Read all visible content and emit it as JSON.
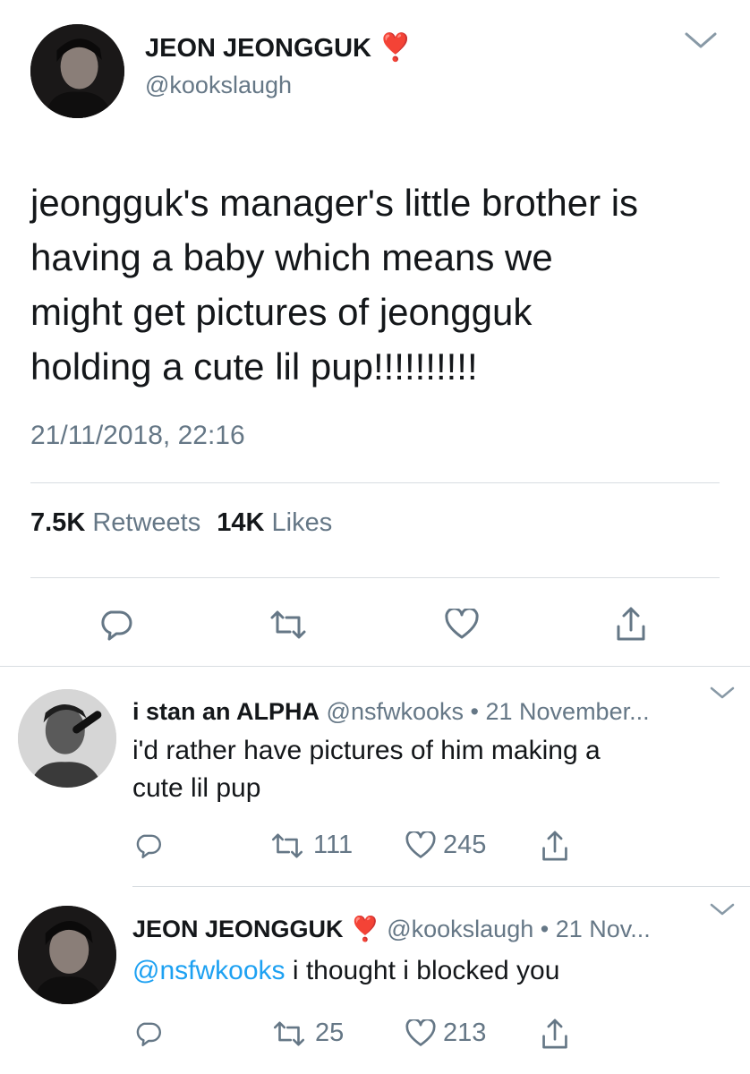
{
  "main_tweet": {
    "display_name": "JEON JEONGGUK",
    "name_emoji": "❣️",
    "handle": "@kookslaugh",
    "text_lines": [
      "jeongguk's manager's little brother is",
      "having a baby which means we",
      "might get pictures of jeongguk",
      "holding a cute lil pup!!!!!!!!!!"
    ],
    "timestamp": "21/11/2018, 22:16",
    "retweets_count": "7.5K",
    "retweets_label": "Retweets",
    "likes_count": "14K",
    "likes_label": "Likes"
  },
  "replies": [
    {
      "display_name": "i stan an ALPHA",
      "handle": "@nsfwkooks",
      "separator": "•",
      "date": "21 November...",
      "text_lines": [
        "i'd rather have pictures of him making a",
        "cute lil pup"
      ],
      "retweets": "111",
      "likes": "245"
    },
    {
      "display_name": "JEON JEONGGUK",
      "name_emoji": "❣️",
      "handle": "@kookslaugh",
      "separator": "•",
      "date": "21 Nov...",
      "mention": "@nsfwkooks",
      "text_after_mention": " i thought i blocked you",
      "retweets": "25",
      "likes": "213"
    }
  ],
  "icons": {
    "reply": "reply-icon",
    "retweet": "retweet-icon",
    "like": "heart-icon",
    "share": "share-icon",
    "more": "chevron-down-icon"
  },
  "colors": {
    "text": "#14171a",
    "muted": "#657786",
    "link": "#1da1f2",
    "divider": "#d8dde1",
    "emoji_red": "#e0245e"
  }
}
